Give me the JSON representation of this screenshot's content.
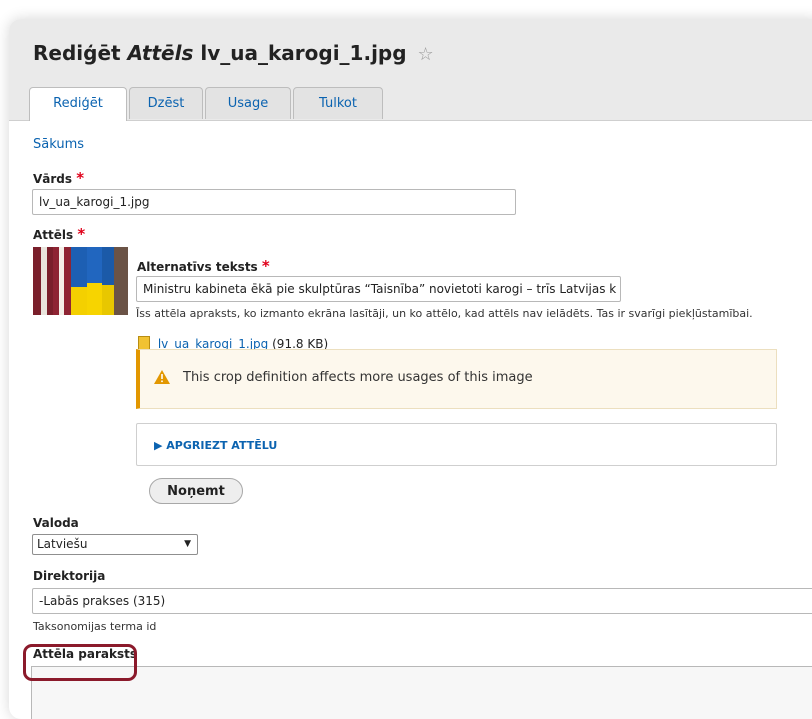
{
  "header": {
    "title_prefix": "Rediģēt",
    "title_type": "Attēls",
    "title_file": "lv_ua_karogi_1.jpg",
    "star": "☆"
  },
  "tabs": [
    {
      "label": "Rediģēt",
      "active": true
    },
    {
      "label": "Dzēst",
      "active": false
    },
    {
      "label": "Usage",
      "active": false
    },
    {
      "label": "Tulkot",
      "active": false
    }
  ],
  "breadcrumb": "Sākums",
  "name_field": {
    "label": "Vārds",
    "value": "lv_ua_karogi_1.jpg",
    "required_mark": "*"
  },
  "image_field": {
    "label": "Attēls",
    "required_mark": "*",
    "alt_label": "Alternatīvs teksts",
    "alt_value": "Ministru kabineta ēkā pie skulptūras “Taisnība” novietoti karogi – trīs Latvijas k",
    "alt_description": "Īss attēla apraksts, ko izmanto ekrāna lasītāji, un ko attēlo, kad attēls nav ielādēts. Tas ir svarīgi piekļūstamībai.",
    "file_link": "lv_ua_karogi_1.jpg",
    "file_size": "(91.8 KB)",
    "warning": "This crop definition affects more usages of this image",
    "crop_summary": "▶ APGRIEZT ATTĒLU",
    "remove_button": "Noņemt"
  },
  "language_field": {
    "label": "Valoda",
    "value": "Latviešu"
  },
  "directory_field": {
    "label": "Direktorija",
    "value": "-Labās prakses (315)",
    "description": "Taksonomijas terma id"
  },
  "caption_field": {
    "label": "Attēla paraksts"
  },
  "colors": {
    "link": "#0b63b0",
    "required": "#e0001a",
    "warning_border": "#e29700",
    "highlight": "#8b1a2b"
  }
}
